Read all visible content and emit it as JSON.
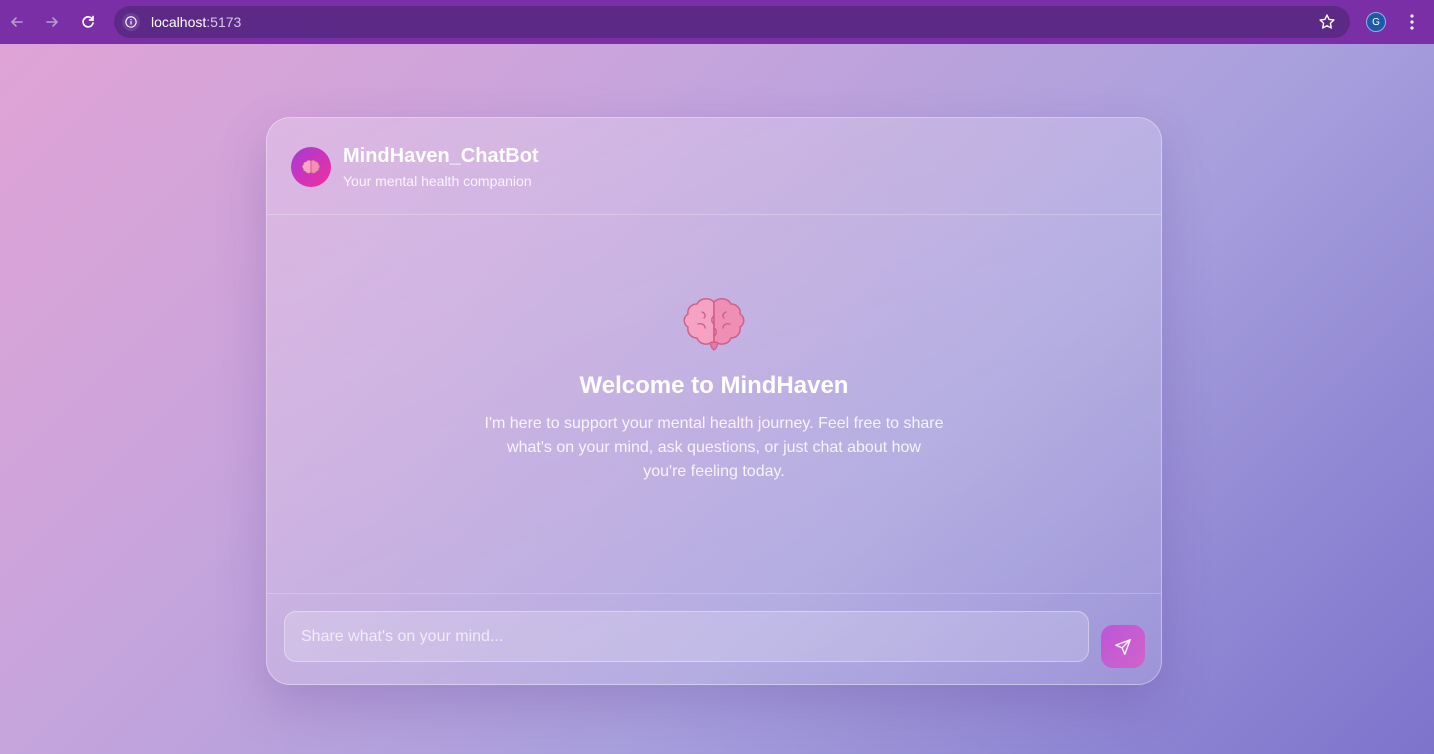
{
  "browser": {
    "url_host": "localhost",
    "url_port": ":5173",
    "profile_initial": "G"
  },
  "header": {
    "title": "MindHaven_ChatBot",
    "subtitle": "Your mental health companion",
    "avatar_icon": "brain-icon"
  },
  "welcome": {
    "icon": "brain-icon",
    "title": "Welcome to MindHaven",
    "message": "I'm here to support your mental health journey. Feel free to share what's on your mind, ask questions, or just chat about how you're feeling today."
  },
  "composer": {
    "placeholder": "Share what's on your mind...",
    "send_icon": "send-icon"
  },
  "colors": {
    "browser_chrome": "#7a2fa6",
    "accent": "#c04ed8",
    "avatar_gradient_end": "#f02fa0"
  }
}
